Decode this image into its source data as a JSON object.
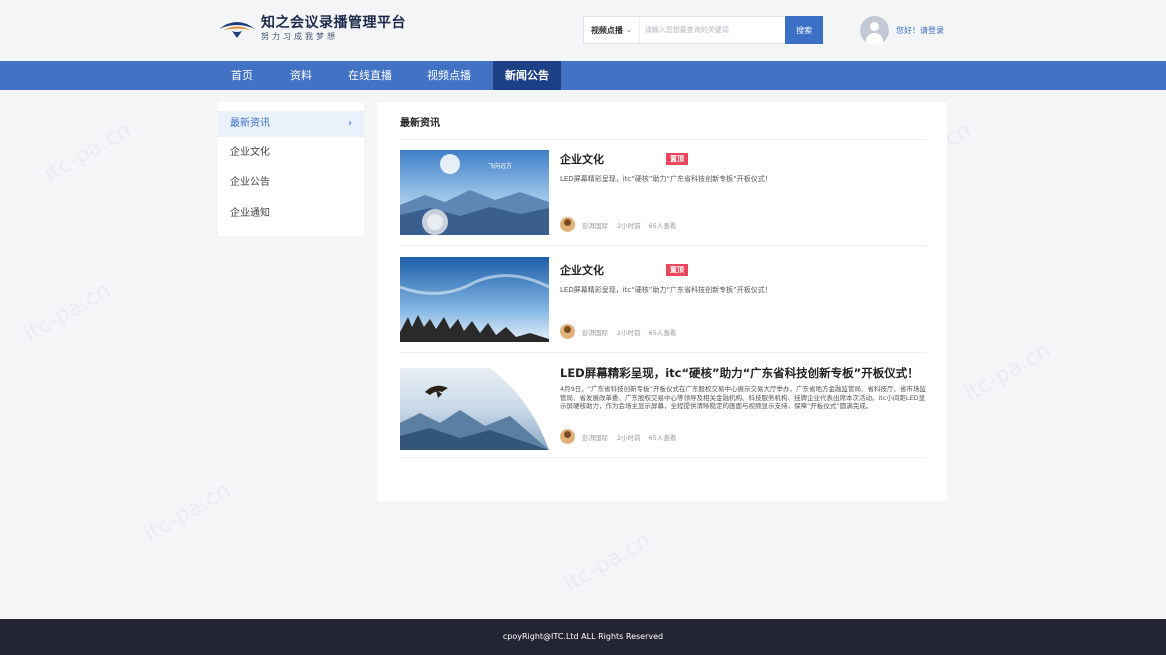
{
  "header": {
    "title": "知之会议录播管理平台",
    "slogan": "努力习成我梦想",
    "search": {
      "select_value": "视频点播",
      "placeholder": "请输入您想要查询的关键词",
      "button_label": "搜索"
    },
    "user_greeting": "您好！请登录"
  },
  "nav": {
    "items": [
      {
        "label": "首页"
      },
      {
        "label": "资料"
      },
      {
        "label": "在线直播"
      },
      {
        "label": "视频点播"
      },
      {
        "label": "新闻公告",
        "active": true
      }
    ]
  },
  "sidebar": {
    "items": [
      {
        "label": "最新资讯",
        "active": true
      },
      {
        "label": "企业文化"
      },
      {
        "label": "企业公告"
      },
      {
        "label": "企业通知"
      }
    ]
  },
  "main": {
    "title": "最新资讯",
    "articles": [
      {
        "title": "企业文化",
        "badge": "置顶",
        "summary": "LED屏幕精彩呈现，itc“硬核”助力“广东省科技创新专板”开板仪式！",
        "author": "彭湃国际",
        "time": "2小时前",
        "views": "65人查看",
        "image_caption": "飞向远方"
      },
      {
        "title": "企业文化",
        "badge": "置顶",
        "summary": "LED屏幕精彩呈现，itc“硬核”助力“广东省科技创新专板”开板仪式！",
        "author": "彭湃国际",
        "time": "2小时前",
        "views": "65人查看"
      },
      {
        "title": "LED屏幕精彩呈现，itc“硬核”助力“广东省科技创新专板”开板仪式！",
        "description": "4月9日，“广东省科技创新专板”开板仪式在广东股权交易中心展示交易大厅举办，广东省地方金融监管局、省科技厅、省市场监管局、省发展改革委、广东股权交易中心等领导及相关金融机构、科技服务机构、挂牌企业代表出席本次活动。itc小间距LED显示屏硬核助力，作为会场主显示屏幕，全程提供清晰稳定的画面与视频显示支持，保障“开板仪式”圆满完成。",
        "author": "彭湃国际",
        "time": "2小时前",
        "views": "65人查看"
      }
    ]
  },
  "footer": {
    "copyright": "cpoyRight@ITC.Ltd ALL Rights Reserved"
  },
  "watermark": "itc-pa.cn",
  "colors": {
    "nav_bg": "#4172c4",
    "nav_active": "#1d3f86",
    "accent": "#3c6fc6",
    "badge": "#e8475c",
    "footer_bg": "#232533"
  }
}
